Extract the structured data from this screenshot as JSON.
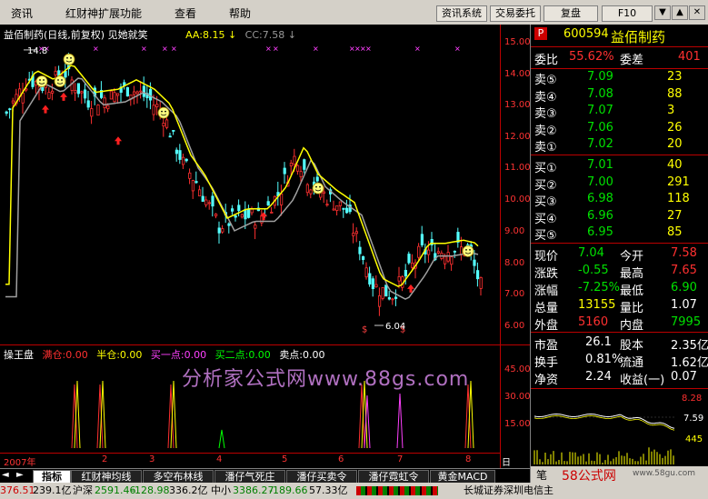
{
  "menu": {
    "items": [
      "资讯",
      "红财神扩展功能",
      "查看",
      "帮助"
    ],
    "buttons": [
      "资讯系统",
      "交易委托",
      "复盘",
      "F10"
    ],
    "win_controls": [
      "▼",
      "▲",
      "✕"
    ]
  },
  "chart": {
    "stock_title": "益佰制药(日线,前复权) 见她就笑",
    "aa_label": "AA:8.15",
    "cc_label": "CC:7.58",
    "price_labels": [
      "15.00",
      "14.00",
      "13.00",
      "12.00",
      "11.00",
      "10.00",
      "9.00",
      "8.00",
      "7.00",
      "6.00"
    ],
    "high_marker": "14.8",
    "low_marker": "6.04",
    "sub_indicator": {
      "title": "操王盘",
      "items": [
        {
          "label": "满仓:0.00",
          "color": "#ff3030"
        },
        {
          "label": "半仓:0.00",
          "color": "#ffff00"
        },
        {
          "label": "买一点:0.00",
          "color": "#ff40ff"
        },
        {
          "label": "买二点:0.00",
          "color": "#00ff00"
        },
        {
          "label": "卖点:0.00",
          "color": "#ffffff"
        }
      ],
      "axis_labels": [
        "45.00",
        "30.00",
        "15.00"
      ]
    },
    "watermark": "分析家公式网www.88gs.com",
    "date_labels": [
      "2007年",
      "2",
      "3",
      "4",
      "5",
      "6",
      "7",
      "8"
    ],
    "date_axis_name": "日线"
  },
  "tabs": [
    "指标",
    "红财神均线",
    "多空布林线",
    "潘仔气死庄",
    "潘仔买卖令",
    "潘仔霓虹令",
    "黄金MACD"
  ],
  "status": {
    "sh": "376.51",
    "sh_amt": "239.1亿",
    "hs_label": "沪深",
    "hs": "2591.46",
    "hs_chg": "-128.98",
    "hs_amt": "336.2亿",
    "zx_label": "中小",
    "zx": "3386.27",
    "zx_chg": "-189.66",
    "zx_amt": "57.33亿",
    "broker": "长城证券深圳电信主",
    "logo": "58公式网",
    "logo_url": "www.58gu.com"
  },
  "quote": {
    "code": "600594",
    "name": "益佰制药",
    "wb_label": "委比",
    "wb": "55.62%",
    "wc_label": "委差",
    "wc": "401",
    "asks": [
      {
        "label": "卖⑤",
        "price": "7.09",
        "vol": "23"
      },
      {
        "label": "卖④",
        "price": "7.08",
        "vol": "88"
      },
      {
        "label": "卖③",
        "price": "7.07",
        "vol": "3"
      },
      {
        "label": "卖②",
        "price": "7.06",
        "vol": "26"
      },
      {
        "label": "卖①",
        "price": "7.02",
        "vol": "20"
      }
    ],
    "bids": [
      {
        "label": "买①",
        "price": "7.01",
        "vol": "40"
      },
      {
        "label": "买②",
        "price": "7.00",
        "vol": "291"
      },
      {
        "label": "买③",
        "price": "6.98",
        "vol": "118"
      },
      {
        "label": "买④",
        "price": "6.96",
        "vol": "27"
      },
      {
        "label": "买⑤",
        "price": "6.95",
        "vol": "85"
      }
    ],
    "stats": [
      {
        "l1": "现价",
        "v1": "7.04",
        "l2": "今开",
        "v2": "7.58"
      },
      {
        "l1": "涨跌",
        "v1": "-0.55",
        "l2": "最高",
        "v2": "7.65"
      },
      {
        "l1": "涨幅",
        "v1": "-7.25%",
        "l2": "最低",
        "v2": "6.90"
      },
      {
        "l1": "总量",
        "v1": "13155",
        "l2": "量比",
        "v2": "1.07"
      },
      {
        "l1": "外盘",
        "v1": "5160",
        "l2": "内盘",
        "v2": "7995"
      }
    ],
    "fund": [
      {
        "l1": "市盈",
        "v1": "26.1",
        "l2": "股本",
        "v2": "2.35亿"
      },
      {
        "l1": "换手",
        "v1": "0.81%",
        "l2": "流通",
        "v2": "1.62亿"
      },
      {
        "l1": "净资",
        "v1": "2.24",
        "l2": "收益(一)",
        "v2": "0.07"
      }
    ],
    "mini_labels": [
      "8.28",
      "7.59",
      "445"
    ],
    "mini_tab": "笔"
  }
}
